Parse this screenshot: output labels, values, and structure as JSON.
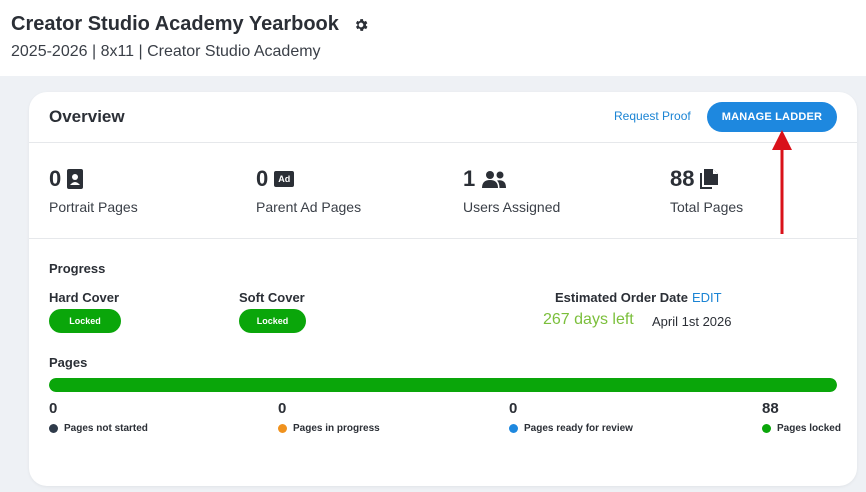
{
  "header": {
    "title": "Creator Studio Academy Yearbook",
    "subtitle": "2025-2026 | 8x11 | Creator Studio Academy"
  },
  "overview": {
    "title": "Overview",
    "request_proof": "Request Proof",
    "manage_ladder": "MANAGE LADDER"
  },
  "stats": [
    {
      "value": "0",
      "label": "Portrait Pages",
      "icon": "portrait-icon"
    },
    {
      "value": "0",
      "label": "Parent Ad Pages",
      "icon": "ad-icon"
    },
    {
      "value": "1",
      "label": "Users Assigned",
      "icon": "users-icon"
    },
    {
      "value": "88",
      "label": "Total Pages",
      "icon": "pages-icon"
    }
  ],
  "ad_badge": "Ad",
  "progress": {
    "title": "Progress",
    "hard_cover": {
      "label": "Hard Cover",
      "status": "Locked"
    },
    "soft_cover": {
      "label": "Soft Cover",
      "status": "Locked"
    },
    "estimated_order": {
      "label": "Estimated Order Date",
      "edit": "EDIT",
      "days_left": "267 days left",
      "date": "April 1st 2026"
    }
  },
  "pages": {
    "title": "Pages",
    "locked_fraction": 1.0,
    "breakdown": [
      {
        "count": "0",
        "label": "Pages not started",
        "color": "#2f3b4a"
      },
      {
        "count": "0",
        "label": "Pages in progress",
        "color": "#f0921e"
      },
      {
        "count": "0",
        "label": "Pages ready for review",
        "color": "#1e88df"
      },
      {
        "count": "88",
        "label": "Pages locked",
        "color": "#0aa60a"
      }
    ]
  },
  "colors": {
    "accent_blue": "#1e88df",
    "locked_green": "#0aa60a",
    "days_left_green": "#7bbf3b",
    "annotation_red": "#d9111a"
  }
}
